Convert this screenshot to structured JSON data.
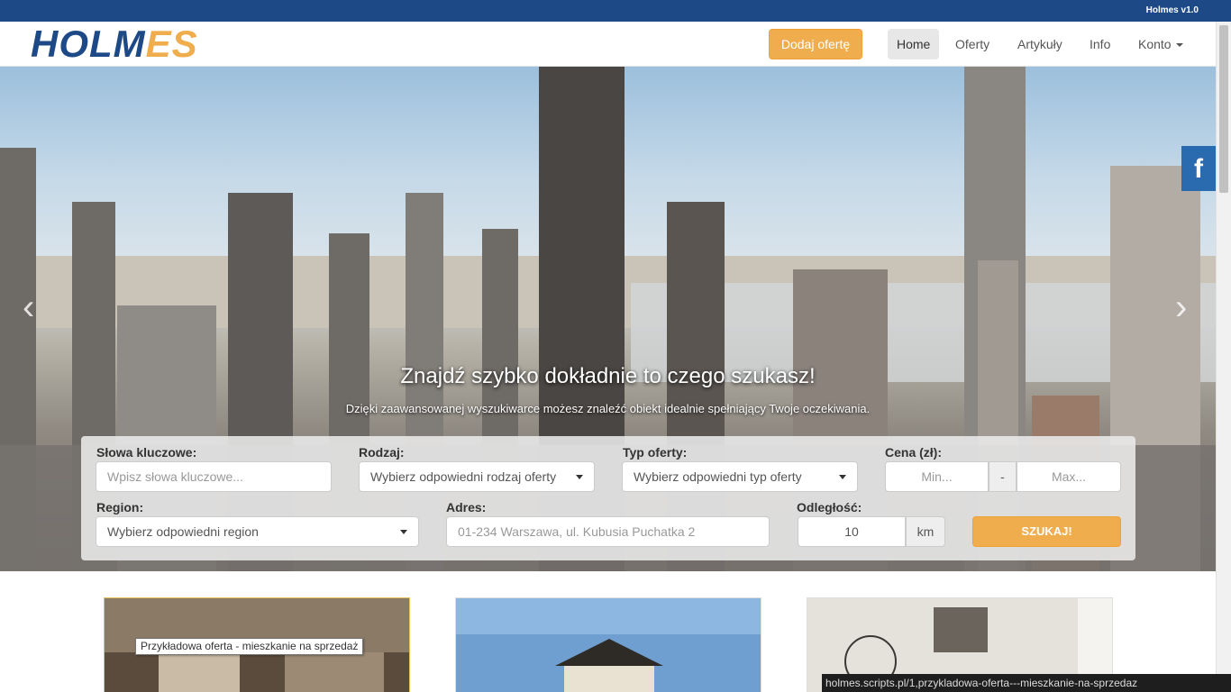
{
  "topbar": {
    "version": "Holmes v1.0"
  },
  "logo": {
    "part1": "HOLM",
    "part2": "ES"
  },
  "nav": {
    "add_offer": "Dodaj ofertę",
    "items": [
      {
        "label": "Home"
      },
      {
        "label": "Oferty"
      },
      {
        "label": "Artykuły"
      },
      {
        "label": "Info"
      },
      {
        "label": "Konto"
      }
    ]
  },
  "hero": {
    "title": "Znajdź szybko dokładnie to czego szukasz!",
    "subtitle": "Dzięki zaawansowanej wyszukiwarce możesz znaleźć obiekt idealnie spełniający Twoje oczekiwania.",
    "facebook": "f",
    "prev": "‹",
    "next": "›"
  },
  "search": {
    "keywords_label": "Słowa kluczowe:",
    "keywords_placeholder": "Wpisz słowa kluczowe...",
    "type_label": "Rodzaj:",
    "type_value": "Wybierz odpowiedni rodzaj oferty",
    "offer_type_label": "Typ oferty:",
    "offer_type_value": "Wybierz odpowiedni typ oferty",
    "price_label": "Cena (zł):",
    "price_min": "Min...",
    "price_sep": "-",
    "price_max": "Max...",
    "region_label": "Region:",
    "region_value": "Wybierz odpowiedni region",
    "address_label": "Adres:",
    "address_placeholder": "01-234 Warszawa, ul. Kubusia Puchatka 2",
    "distance_label": "Odległość:",
    "distance_value": "10",
    "distance_unit": "km",
    "submit": "SZUKAJ!"
  },
  "tooltip": "Przykładowa oferta - mieszkanie na sprzedaż",
  "statusbar": "holmes.scripts.pl/1,przykladowa-oferta---mieszkanie-na-sprzedaz"
}
